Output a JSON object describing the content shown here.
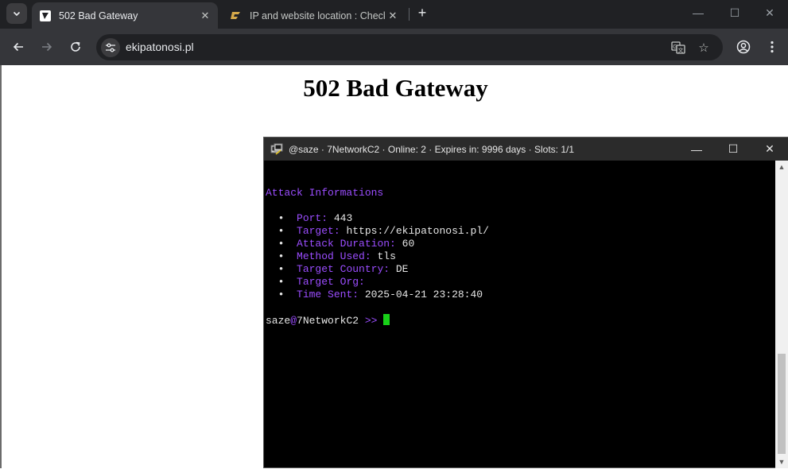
{
  "browser": {
    "tabs": [
      {
        "title": "502 Bad Gateway",
        "active": true
      },
      {
        "title": "IP and website location : Check",
        "active": false
      }
    ],
    "url": "ekipatonosi.pl",
    "window_controls": {
      "minimize": "—",
      "maximize": "☐",
      "close": "✕"
    }
  },
  "page": {
    "heading": "502 Bad Gateway"
  },
  "terminal": {
    "title": "@saze · 7NetworkC2 · Online: 2 · Expires in: 9996 days · Slots: 1/1",
    "section_header": "Attack Informations",
    "bullet": "•",
    "fields": [
      {
        "label": "Port:",
        "value": "443"
      },
      {
        "label": "Target:",
        "value": "https://ekipatonosi.pl/"
      },
      {
        "label": "Attack Duration:",
        "value": "60"
      },
      {
        "label": "Method Used:",
        "value": "tls"
      },
      {
        "label": "Target Country:",
        "value": "DE"
      },
      {
        "label": "Target Org:",
        "value": ""
      },
      {
        "label": "Time Sent:",
        "value": "2025-04-21 23:28:40"
      }
    ],
    "prompt": {
      "user": "saze",
      "at": "@",
      "host": "7NetworkC2",
      "arrow": ">>"
    },
    "colors": {
      "accent": "#9b4dff",
      "cursor": "#18d018",
      "background": "#000000"
    }
  },
  "icons": {
    "tab_search": "chevron-down-icon",
    "close": "close-icon",
    "new_tab": "plus-icon",
    "back": "back-arrow-icon",
    "forward": "forward-arrow-icon",
    "reload": "reload-icon",
    "site_info": "tune-icon",
    "translate": "translate-icon",
    "bookmark": "star-icon",
    "profile": "profile-icon",
    "menu": "kebab-menu-icon"
  }
}
